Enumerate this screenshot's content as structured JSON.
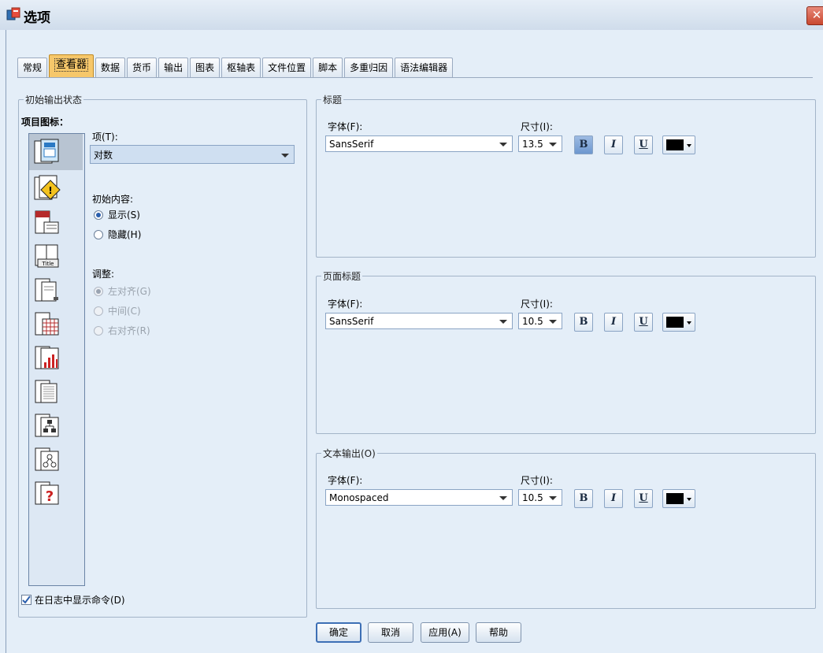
{
  "window": {
    "title": "选项",
    "close_icon": "close-icon"
  },
  "tabs": [
    {
      "label": "常规",
      "active": false
    },
    {
      "label": "查看器",
      "active": true
    },
    {
      "label": "数据",
      "active": false
    },
    {
      "label": "货币",
      "active": false
    },
    {
      "label": "输出",
      "active": false
    },
    {
      "label": "图表",
      "active": false
    },
    {
      "label": "枢轴表",
      "active": false
    },
    {
      "label": "文件位置",
      "active": false
    },
    {
      "label": "脚本",
      "active": false
    },
    {
      "label": "多重归因",
      "active": false
    },
    {
      "label": "语法编辑器",
      "active": false
    }
  ],
  "initial_output": {
    "legend": "初始输出状态",
    "item_icon_label": "项目图标：",
    "item_label": "项(T):",
    "item_value": "对数",
    "initial_content_label": "初始内容:",
    "show_label": "显示(S)",
    "hide_label": "隐藏(H)",
    "align_label": "调整:",
    "align_left_label": "左对齐(G)",
    "align_center_label": "中间(C)",
    "align_right_label": "右对齐(R)",
    "icons": [
      "log-icon",
      "warning-icon",
      "notes-icon",
      "title-icon",
      "page-title-icon",
      "pivot-table-icon",
      "chart-icon",
      "text-output-icon",
      "tree-model-icon",
      "model-viewer-icon",
      "unknown-object-icon"
    ],
    "log_commands_label": "在日志中显示命令(D)",
    "log_commands_checked": true
  },
  "title_group": {
    "legend": "标题",
    "font_label": "字体(F):",
    "font_value": "SansSerif",
    "size_label": "尺寸(I):",
    "size_value": "13.5",
    "bold": "B",
    "italic": "I",
    "underline": "U",
    "bold_pressed": true
  },
  "page_title_group": {
    "legend": "页面标题",
    "font_label": "字体(F):",
    "font_value": "SansSerif",
    "size_label": "尺寸(I):",
    "size_value": "10.5",
    "bold": "B",
    "italic": "I",
    "underline": "U"
  },
  "text_output_group": {
    "legend": "文本输出(O)",
    "font_label": "字体(F):",
    "font_value": "Monospaced",
    "size_label": "尺寸(I):",
    "size_value": "10.5",
    "bold": "B",
    "italic": "I",
    "underline": "U"
  },
  "buttons": {
    "ok": "确定",
    "cancel": "取消",
    "apply": "应用(A)",
    "help": "帮助"
  },
  "colors": {
    "dialog_bg": "#e4eef8",
    "active_tab": "#f6c76a",
    "accent": "#3d6fb5"
  }
}
